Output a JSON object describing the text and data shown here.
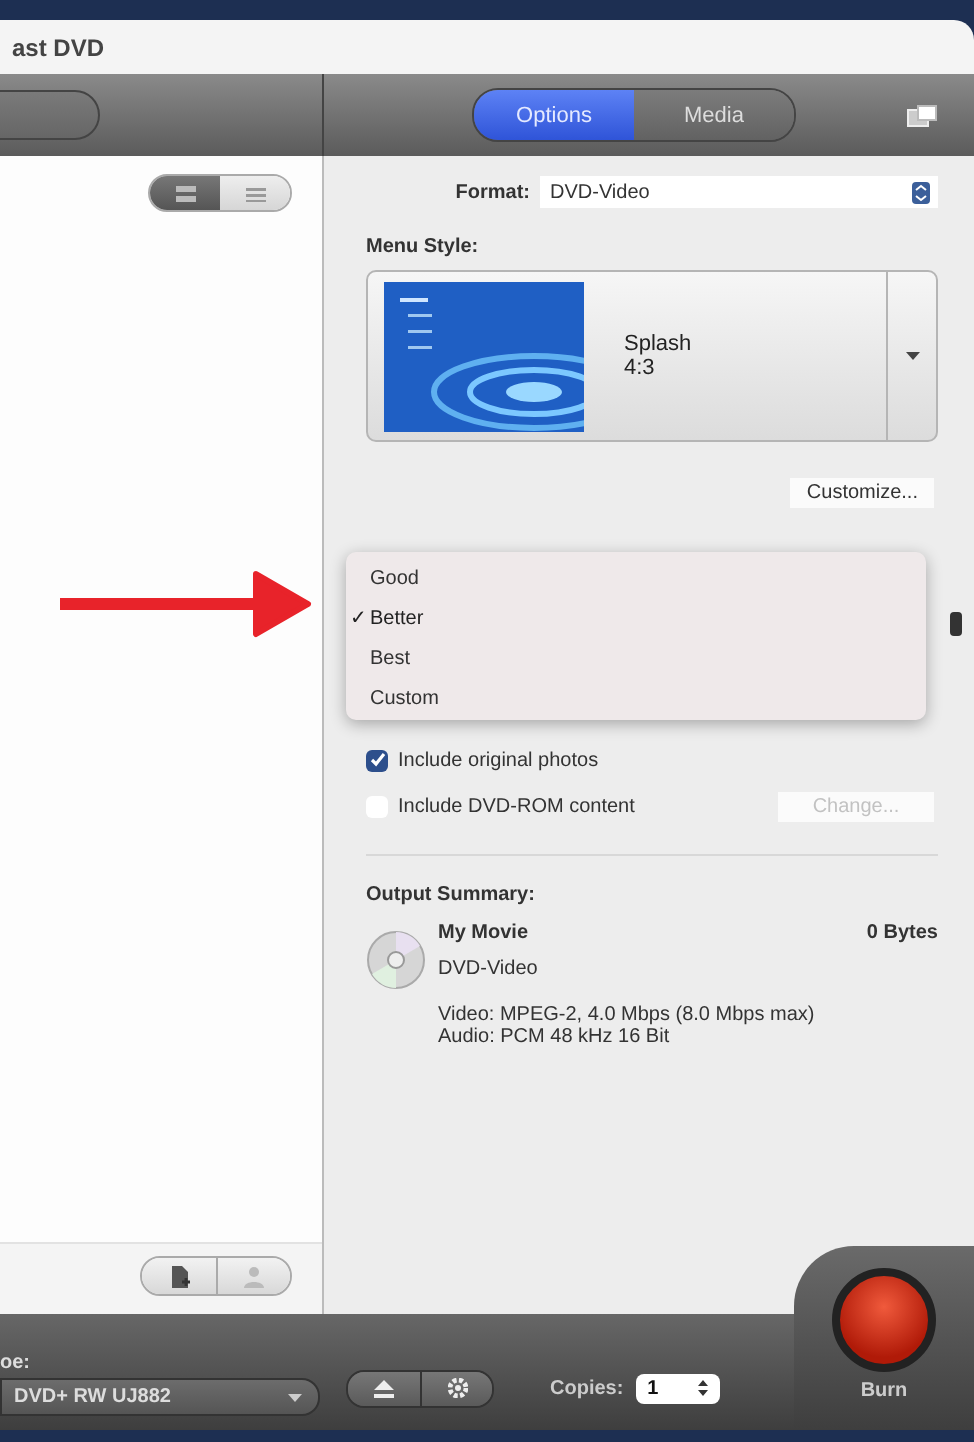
{
  "window": {
    "title": "ast DVD"
  },
  "toolbar": {
    "tabs": [
      {
        "label": "Options",
        "selected": true
      },
      {
        "label": "Media",
        "selected": false
      }
    ]
  },
  "view_toggle": [
    {
      "selected": true
    },
    {
      "selected": false
    }
  ],
  "format": {
    "label": "Format:",
    "value": "DVD-Video"
  },
  "menu_style": {
    "label": "Menu Style:",
    "name": "Splash",
    "aspect": "4:3"
  },
  "customize_button": "Customize...",
  "quality_menu": [
    {
      "label": "Good",
      "selected": false
    },
    {
      "label": "Better",
      "selected": true
    },
    {
      "label": "Best",
      "selected": false
    },
    {
      "label": "Custom",
      "selected": false
    }
  ],
  "check_mark": "✓",
  "options": [
    {
      "label": "Include original photos",
      "checked": true
    },
    {
      "label": "Include DVD-ROM content",
      "checked": false
    }
  ],
  "change_button": {
    "label": "Change...",
    "disabled": true
  },
  "output_summary": {
    "heading": "Output Summary:",
    "title": "My Movie",
    "size": "0 Bytes",
    "format": "DVD-Video",
    "video": "Video: MPEG-2, 4.0 Mbps (8.0 Mbps max)",
    "audio": "Audio: PCM 48 kHz 16 Bit"
  },
  "bottom_bar": {
    "drive_label": "oe:",
    "drive": "DVD+ RW UJ882",
    "copies_label": "Copies:",
    "copies": "1",
    "burn_label": "Burn"
  }
}
